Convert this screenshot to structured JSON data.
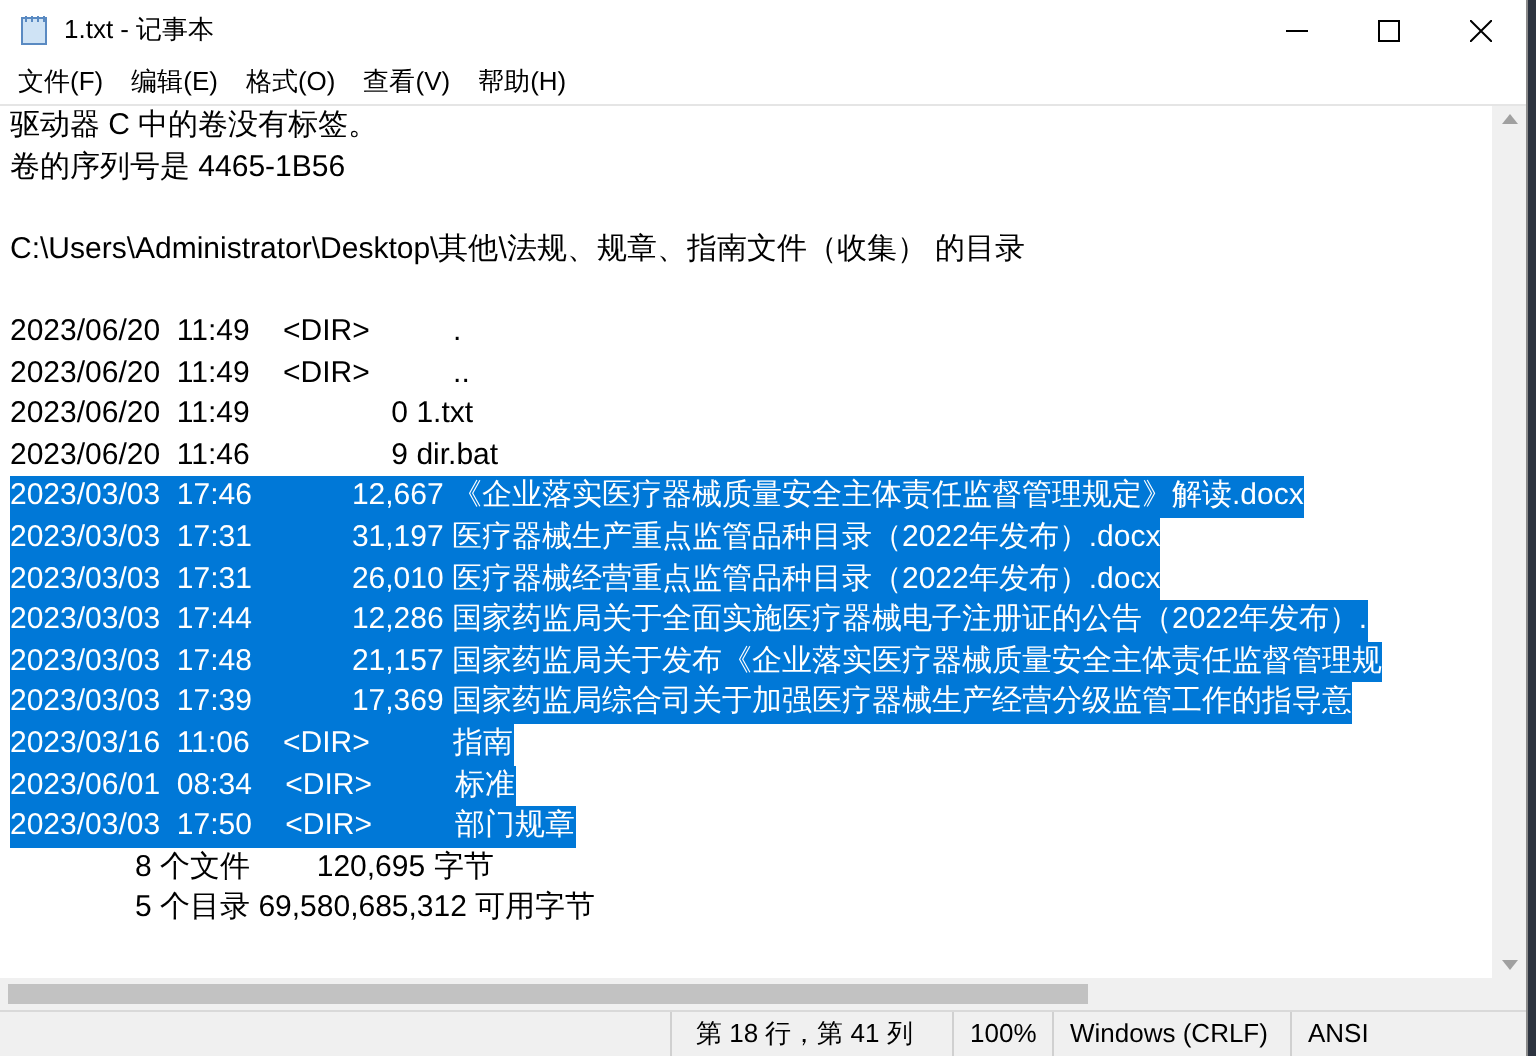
{
  "window": {
    "title": "1.txt - 记事本"
  },
  "menu": [
    "文件(F)",
    "编辑(E)",
    "格式(O)",
    "查看(V)",
    "帮助(H)"
  ],
  "text_blocks": [
    [
      {
        "text": "驱动器 C 中的卷没有标签。",
        "selected": false
      },
      {
        "text": "卷的序列号是 4465-1B56",
        "selected": false
      }
    ],
    [
      {
        "text": "C:\\Users\\Administrator\\Desktop\\其他\\法规、规章、指南文件（收集） 的目录",
        "selected": false
      }
    ],
    [
      {
        "text": "2023/06/20  11:49    <DIR>          .",
        "selected": false
      },
      {
        "text": "2023/06/20  11:49    <DIR>          ..",
        "selected": false
      },
      {
        "text": "2023/06/20  11:49                 0 1.txt",
        "selected": false
      },
      {
        "text": "2023/06/20  11:46                 9 dir.bat",
        "selected": false
      },
      {
        "text": "2023/03/03  17:46            12,667 《企业落实医疗器械质量安全主体责任监督管理规定》解读.docx",
        "selected": true
      },
      {
        "text": "2023/03/03  17:31            31,197 医疗器械生产重点监管品种目录（2022年发布）.docx",
        "selected": true
      },
      {
        "text": "2023/03/03  17:31            26,010 医疗器械经营重点监管品种目录（2022年发布）.docx",
        "selected": true
      },
      {
        "text": "2023/03/03  17:44            12,286 国家药监局关于全面实施医疗器械电子注册证的公告（2022年发布）.",
        "selected": true
      },
      {
        "text": "2023/03/03  17:48            21,157 国家药监局关于发布《企业落实医疗器械质量安全主体责任监督管理规",
        "selected": true
      },
      {
        "text": "2023/03/03  17:39            17,369 国家药监局综合司关于加强医疗器械生产经营分级监管工作的指导意",
        "selected": true
      },
      {
        "text": "2023/03/16  11:06    <DIR>          指南",
        "selected": true
      },
      {
        "text": "2023/06/01  08:34    <DIR>          标准",
        "selected": true
      },
      {
        "text": "2023/03/03  17:50    <DIR>          部门规章",
        "selected": true
      },
      {
        "text": "               8 个文件        120,695 字节",
        "selected": false
      },
      {
        "text": "               5 个目录 69,580,685,312 可用字节",
        "selected": false
      }
    ]
  ],
  "status_bar": {
    "position": "第 18 行，第 41 列",
    "zoom": "100%",
    "line_ending": "Windows (CRLF)",
    "encoding": "ANSI"
  }
}
